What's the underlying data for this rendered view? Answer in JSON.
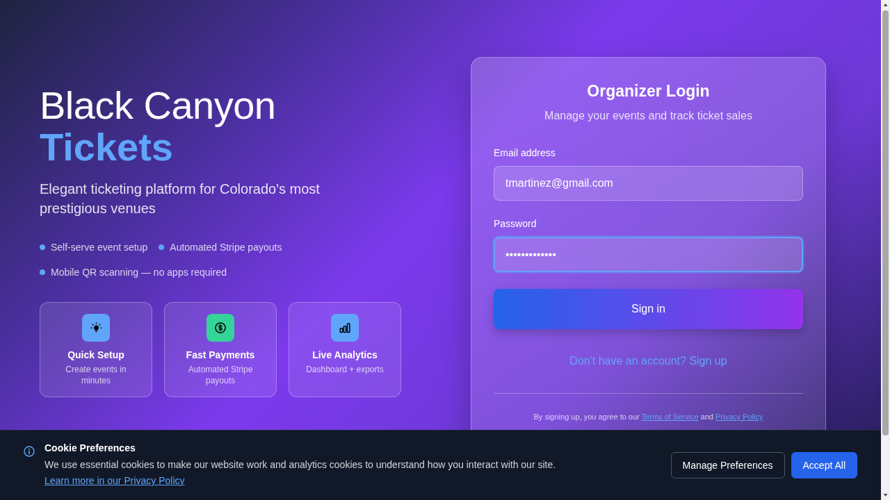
{
  "hero": {
    "title": "Black Canyon",
    "title_accent": "Tickets",
    "tagline": "Elegant ticketing platform for Colorado's most prestigious venues",
    "bullets": [
      "Self-serve event setup",
      "Automated Stripe payouts",
      "Mobile QR scanning — no apps required"
    ]
  },
  "features": [
    {
      "title": "Quick Setup",
      "description": "Create events in minutes",
      "color": "#60a5fa"
    },
    {
      "title": "Fast Payments",
      "description": "Automated Stripe payouts",
      "color": "#34d399"
    },
    {
      "title": "Live Analytics",
      "description": "Dashboard + exports",
      "color": "#60a5fa"
    }
  ],
  "login": {
    "title": "Organizer Login",
    "subtitle": "Manage your events and track ticket sales",
    "fields": [
      {
        "label": "Email address",
        "value": "tmartinez@gmail.com",
        "focused": false
      },
      {
        "label": "Password",
        "value": "•••••••••••••",
        "focused": true
      }
    ],
    "submit": "Sign in",
    "signup_link": "Don't have an account? Sign up",
    "legal": {
      "text": "By signing up, you agree to our",
      "terms_link": "Terms of Service",
      "joiner": "and",
      "privacy_link": "Privacy Policy"
    }
  },
  "cookie_banner": {
    "title": "Cookie Preferences",
    "text": "We use essential cookies to make our website work and analytics cookies to understand how you interact with our site.",
    "link": "Learn more in our Privacy Policy",
    "buttons": [
      {
        "label": "Manage Preferences",
        "kind": "secondary"
      },
      {
        "label": "Accept All",
        "kind": "primary"
      }
    ]
  }
}
